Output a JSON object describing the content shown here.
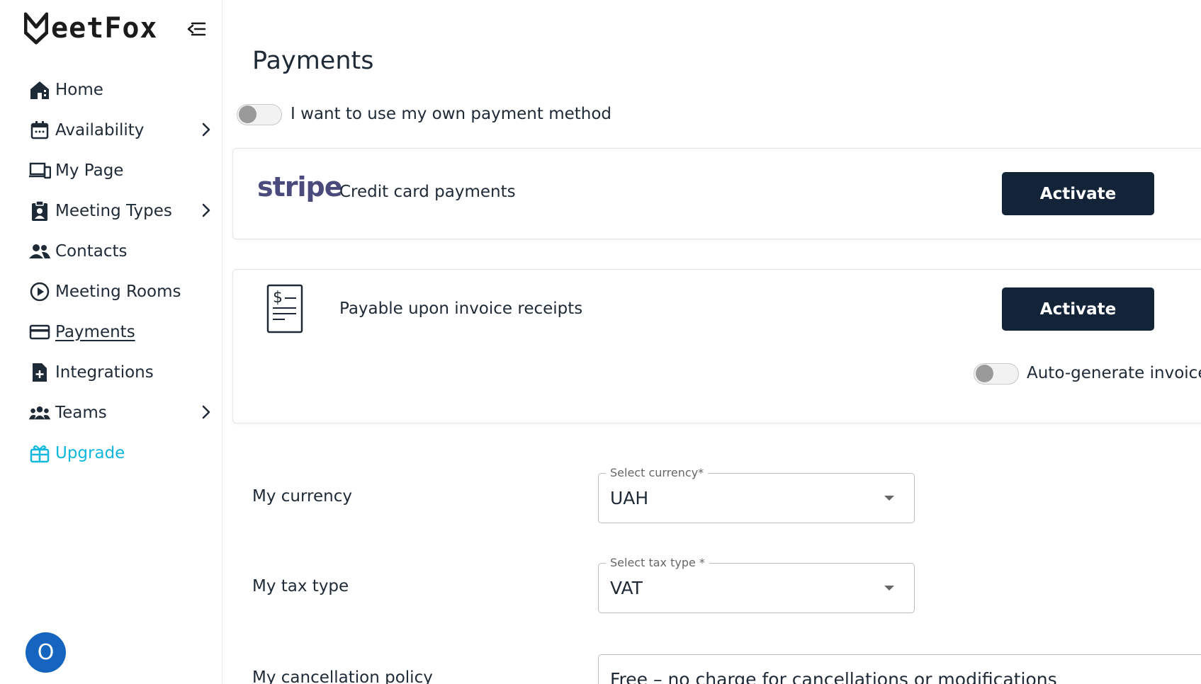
{
  "app": {
    "logo_text": "eetFox"
  },
  "sidebar": {
    "items": [
      {
        "label": "Home"
      },
      {
        "label": "Availability"
      },
      {
        "label": "My Page"
      },
      {
        "label": "Meeting Types"
      },
      {
        "label": "Contacts"
      },
      {
        "label": "Meeting Rooms"
      },
      {
        "label": "Payments"
      },
      {
        "label": "Integrations"
      },
      {
        "label": "Teams"
      },
      {
        "label": "Upgrade"
      }
    ],
    "avatar_initial": "O"
  },
  "main": {
    "title": "Payments",
    "own_method_toggle": {
      "label": "I want to use my own payment method",
      "on": false
    },
    "stripe_card": {
      "logo": "stripe",
      "text": "Credit card payments",
      "button": "Activate"
    },
    "invoice_card": {
      "text": "Payable upon invoice receipts",
      "button": "Activate",
      "auto_toggle": {
        "label": "Auto-generate invoice",
        "on": false
      }
    },
    "currency": {
      "label": "My currency",
      "legend": "Select currency*",
      "value": "UAH"
    },
    "tax": {
      "label": "My tax type",
      "legend": "Select tax type *",
      "value": "VAT"
    },
    "cancellation": {
      "label": "My cancellation policy",
      "value": "Free – no charge for cancellations or modifications"
    }
  },
  "colors": {
    "primary_button": "#142438",
    "upgrade_accent": "#10b7dc",
    "avatar": "#1565c0"
  }
}
